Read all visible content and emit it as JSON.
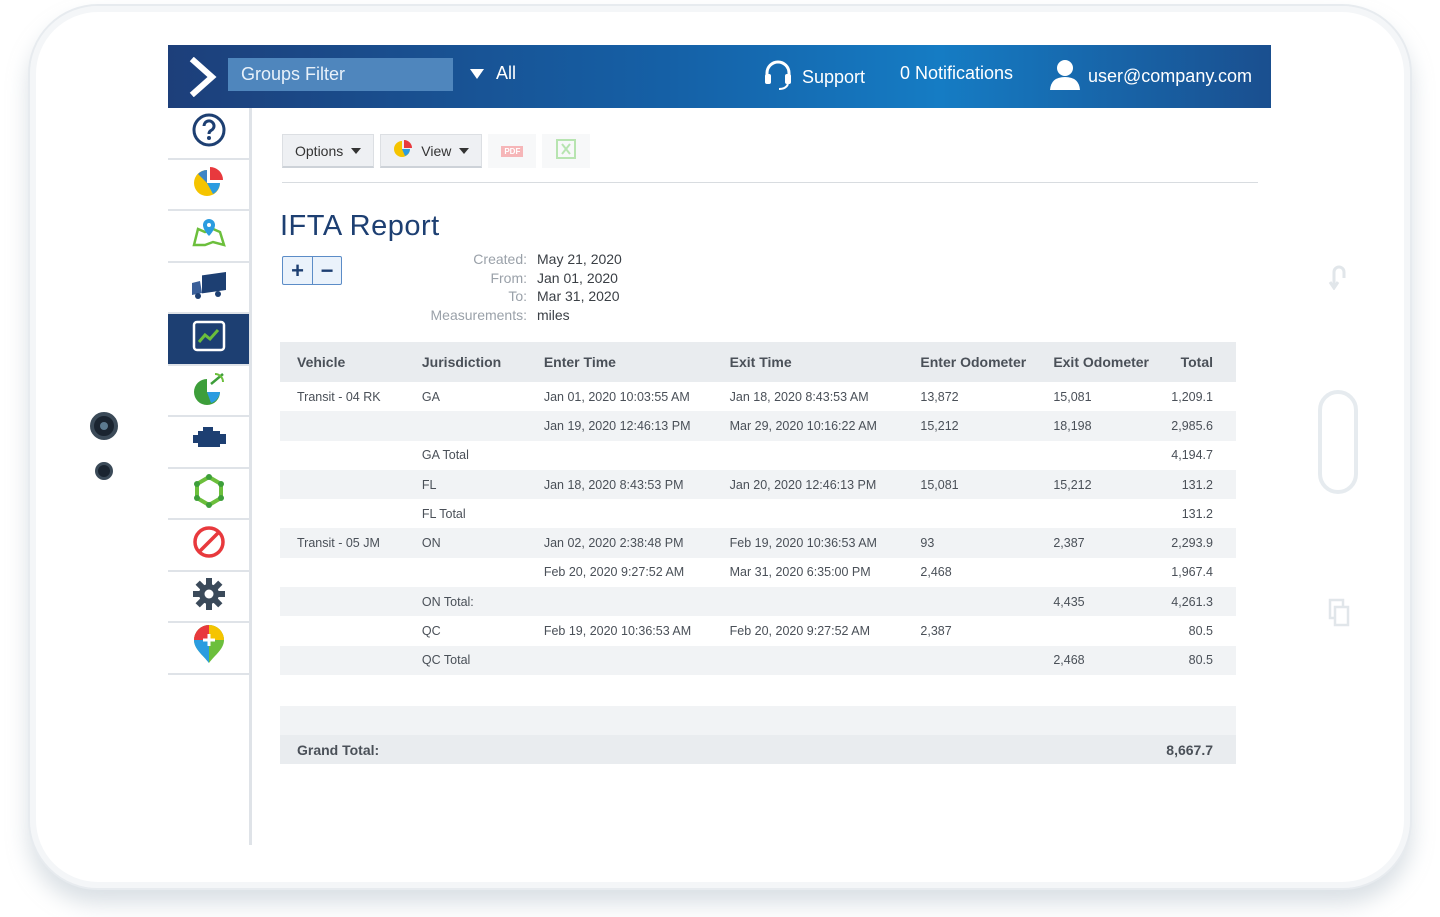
{
  "topbar": {
    "groups_filter": "Groups Filter",
    "all_label": "All",
    "support": "Support",
    "notifications": "0 Notifications",
    "user": "user@company.com"
  },
  "sidebar": {
    "items": [
      {
        "icon": "help-icon"
      },
      {
        "icon": "pie-chart-icon"
      },
      {
        "icon": "map-icon"
      },
      {
        "icon": "truck-icon"
      },
      {
        "icon": "reports-icon",
        "active": true
      },
      {
        "icon": "satellite-icon"
      },
      {
        "icon": "engine-icon"
      },
      {
        "icon": "zone-icon"
      },
      {
        "icon": "rules-icon"
      },
      {
        "icon": "settings-icon"
      },
      {
        "icon": "marketplace-icon"
      }
    ]
  },
  "toolbar": {
    "options_label": "Options",
    "view_label": "View",
    "pdf_label": "PDF"
  },
  "report": {
    "title": "IFTA Report",
    "meta": {
      "created_label": "Created:",
      "created": "May 21, 2020",
      "from_label": "From:",
      "from": "Jan 01, 2020",
      "to_label": "To:",
      "to": "Mar 31, 2020",
      "measurements_label": "Measurements:",
      "measurements": "miles"
    },
    "columns": [
      "Vehicle",
      "Jurisdiction",
      "Enter Time",
      "Exit Time",
      "Enter Odometer",
      "Exit Odometer",
      "Total"
    ],
    "rows": [
      [
        "Transit - 04 RK",
        "GA",
        "Jan 01, 2020 10:03:55 AM",
        "Jan 18, 2020 8:43:53 AM",
        "13,872",
        "15,081",
        "1,209.1"
      ],
      [
        "",
        "",
        "Jan 19, 2020 12:46:13 PM",
        "Mar 29, 2020 10:16:22 AM",
        "15,212",
        "18,198",
        "2,985.6"
      ],
      [
        "",
        "GA Total",
        "",
        "",
        "",
        "",
        "4,194.7"
      ],
      [
        "",
        "FL",
        "Jan 18, 2020 8:43:53 PM",
        "Jan 20, 2020 12:46:13 PM",
        "15,081",
        "15,212",
        "131.2"
      ],
      [
        "",
        "FL Total",
        "",
        "",
        "",
        "",
        "131.2"
      ],
      [
        "Transit - 05 JM",
        "ON",
        "Jan 02, 2020 2:38:48 PM",
        "Feb 19, 2020 10:36:53 AM",
        "93",
        "2,387",
        "2,293.9"
      ],
      [
        "",
        "",
        "Feb 20, 2020 9:27:52 AM",
        "Mar 31, 2020 6:35:00 PM",
        "2,468",
        "",
        "1,967.4"
      ],
      [
        "",
        "ON Total:",
        "",
        "",
        "",
        "4,435",
        "4,261.3"
      ],
      [
        "",
        "QC",
        "Feb 19, 2020 10:36:53 AM",
        "Feb 20, 2020 9:27:52 AM",
        "2,387",
        "",
        "80.5"
      ],
      [
        "",
        "QC Total",
        "",
        "",
        "",
        "2,468",
        "80.5"
      ]
    ],
    "grand_total_label": "Grand Total:",
    "grand_total": "8,667.7"
  }
}
